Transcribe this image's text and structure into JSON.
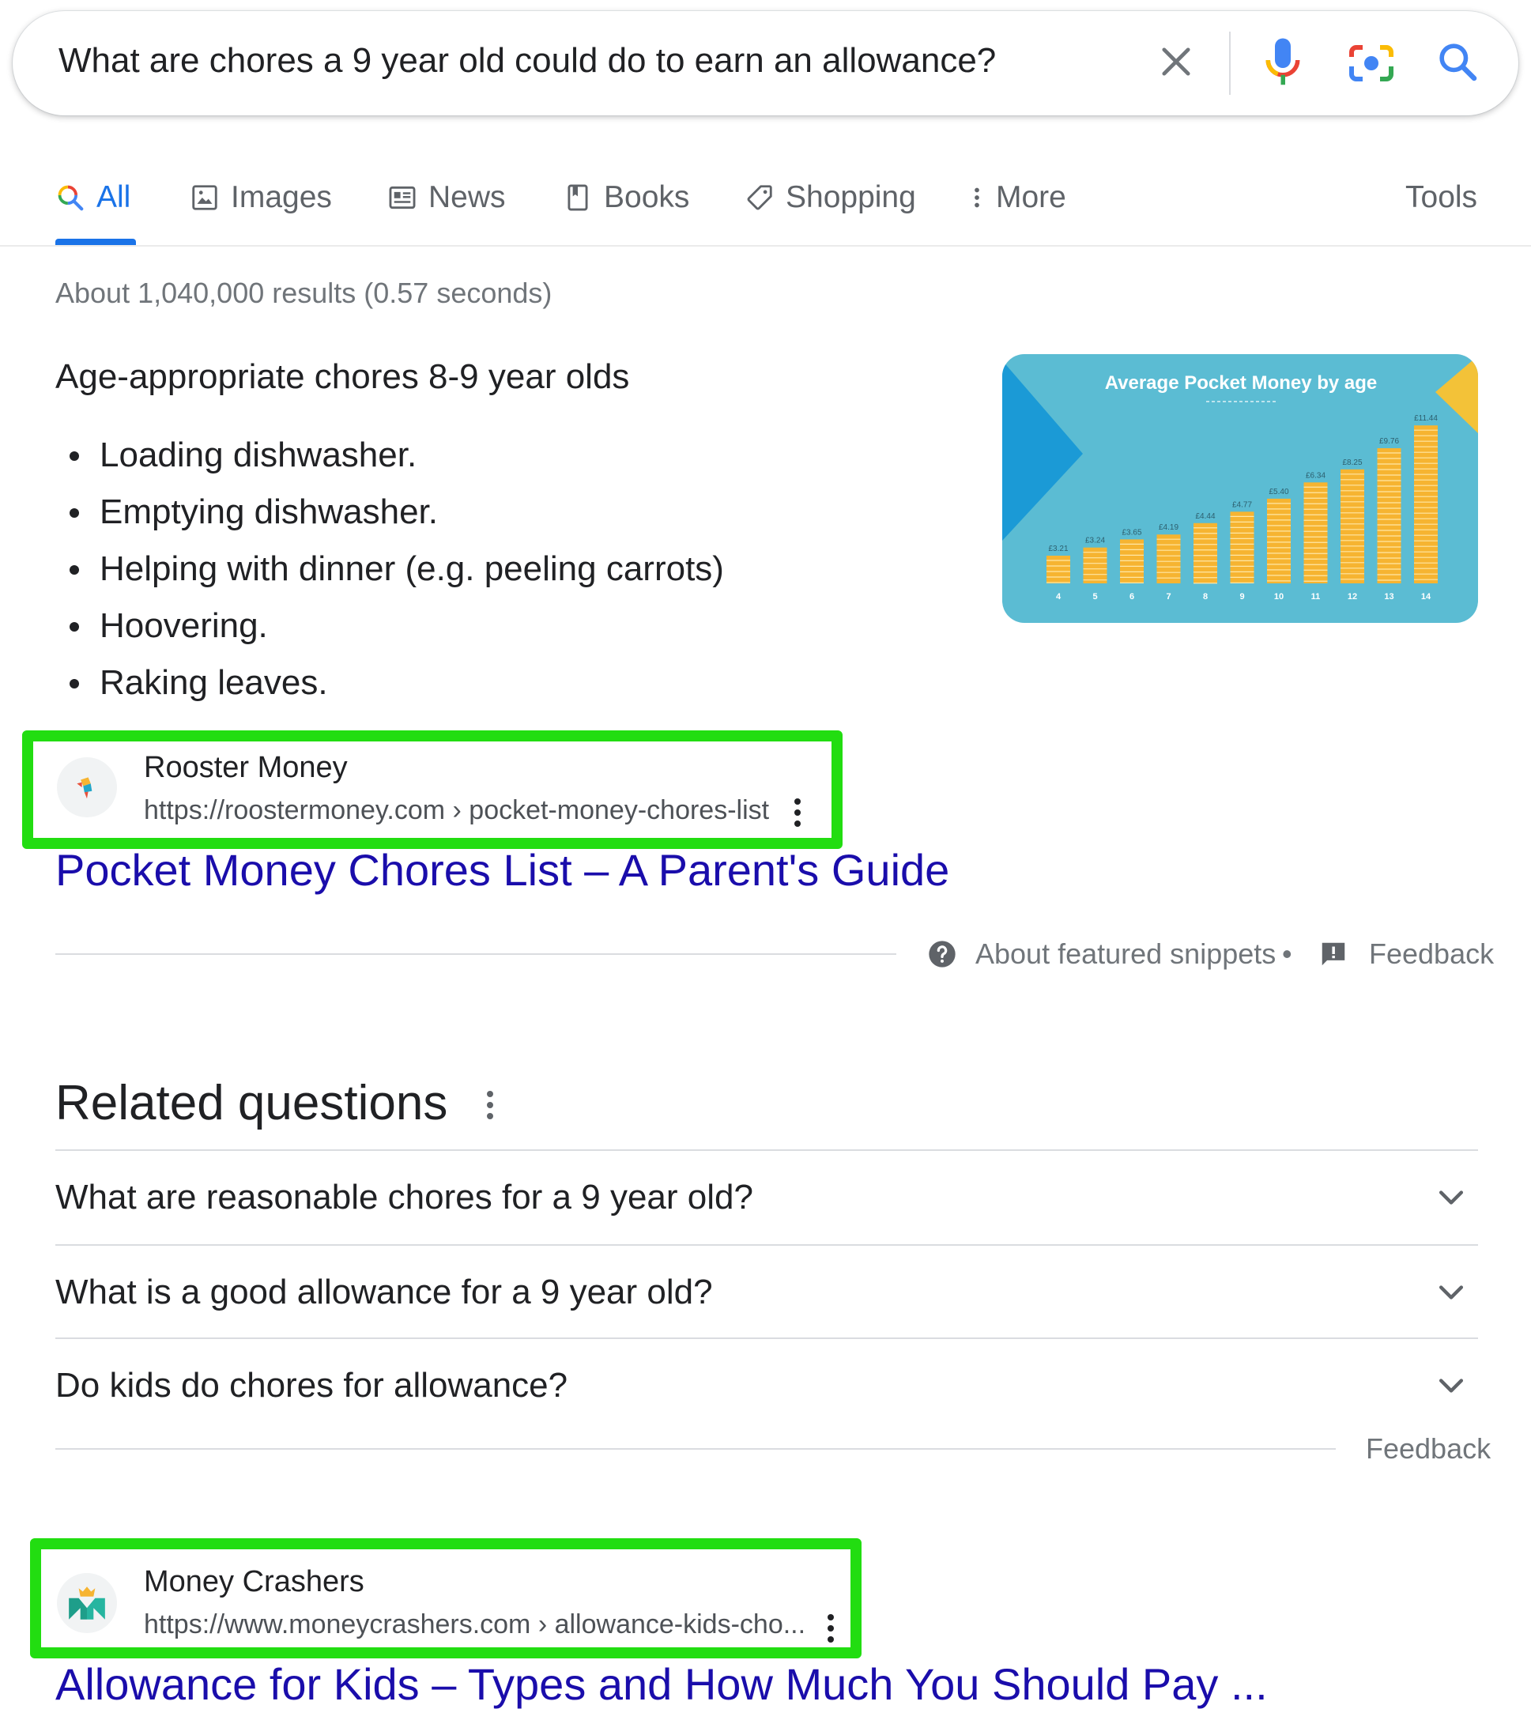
{
  "search": {
    "query": "What are chores a 9 year old could do to earn an allowance?",
    "icons": [
      "close-icon",
      "microphone-icon",
      "camera-lens-icon",
      "search-icon"
    ]
  },
  "tabs": [
    {
      "label": "All",
      "icon": "search-icon",
      "active": true
    },
    {
      "label": "Images",
      "icon": "image-icon"
    },
    {
      "label": "News",
      "icon": "newspaper-icon"
    },
    {
      "label": "Books",
      "icon": "book-icon"
    },
    {
      "label": "Shopping",
      "icon": "tag-icon"
    },
    {
      "label": "More",
      "icon": "vertical-dots-icon"
    }
  ],
  "tools_label": "Tools",
  "stats": "About 1,040,000 results (0.57 seconds)",
  "featured_snippet": {
    "heading": "Age-appropriate chores 8-9 year olds",
    "items": [
      "Loading dishwasher.",
      "Emptying dishwasher.",
      "Helping with dinner (e.g. peeling carrots)",
      "Hoovering.",
      "Raking leaves."
    ],
    "source": {
      "name": "Rooster Money",
      "url": "https://roostermoney.com › pocket-money-chores-list",
      "title": "Pocket Money Chores List – A Parent's Guide"
    },
    "about_label": "About featured snippets",
    "separator": "•",
    "feedback_label": "Feedback"
  },
  "thumbnail": {
    "title": "Average Pocket Money by age",
    "values": [
      "£3.21",
      "£3.24",
      "£3.65",
      "£4.19",
      "£4.44",
      "£4.77",
      "£5.40",
      "£6.34",
      "£8.25",
      "£9.76",
      "£11.44"
    ],
    "ages": [
      "4",
      "5",
      "6",
      "7",
      "8",
      "9",
      "10",
      "11",
      "12",
      "13",
      "14"
    ],
    "bar_levels": [
      0.17,
      0.22,
      0.27,
      0.3,
      0.37,
      0.44,
      0.52,
      0.62,
      0.7,
      0.83,
      0.97
    ],
    "colors": {
      "bg": "#5bbcd3",
      "coin": "#f6b431",
      "arrow": "#1b9ad6",
      "corner": "#f3c238"
    }
  },
  "related": {
    "heading": "Related questions",
    "questions": [
      "What are reasonable chores for a 9 year old?",
      "What is a good allowance for a 9 year old?",
      "Do kids do chores for allowance?"
    ],
    "feedback_label": "Feedback"
  },
  "result2": {
    "name": "Money Crashers",
    "url": "https://www.moneycrashers.com › allowance-kids-cho...",
    "title": "Allowance for Kids – Types and How Much You Should Pay ..."
  },
  "colors": {
    "highlight": "#22dd11",
    "link": "#1a0dab",
    "accent": "#1a73e8"
  }
}
